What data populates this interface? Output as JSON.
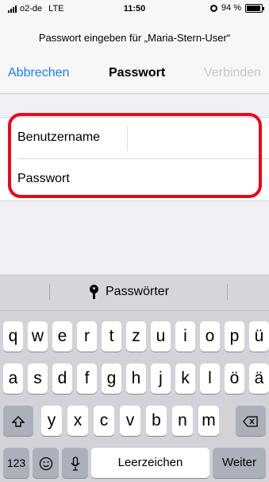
{
  "status": {
    "carrier": "o2-de",
    "network": "LTE",
    "time": "11:50",
    "battery": "94 %",
    "battery_level": 0.94
  },
  "header": {
    "prompt": "Passwort eingeben für „Maria-Stern-User“"
  },
  "nav": {
    "cancel": "Abbrechen",
    "title": "Passwort",
    "connect": "Verbinden"
  },
  "form": {
    "username_label": "Benutzername",
    "password_label": "Passwort"
  },
  "keyboard": {
    "suggestion": "Passwörter",
    "row1": [
      "q",
      "w",
      "e",
      "r",
      "t",
      "z",
      "u",
      "i",
      "o",
      "p",
      "ü"
    ],
    "row2": [
      "a",
      "s",
      "d",
      "f",
      "g",
      "h",
      "j",
      "k",
      "l",
      "ö",
      "ä"
    ],
    "row3": [
      "y",
      "x",
      "c",
      "v",
      "b",
      "n",
      "m"
    ],
    "numbers": "123",
    "space": "Leerzeichen",
    "next": "Weiter"
  },
  "colors": {
    "accent": "#1b7cf5",
    "highlight": "#e30c1b",
    "disabled": "#c8c8cc"
  }
}
